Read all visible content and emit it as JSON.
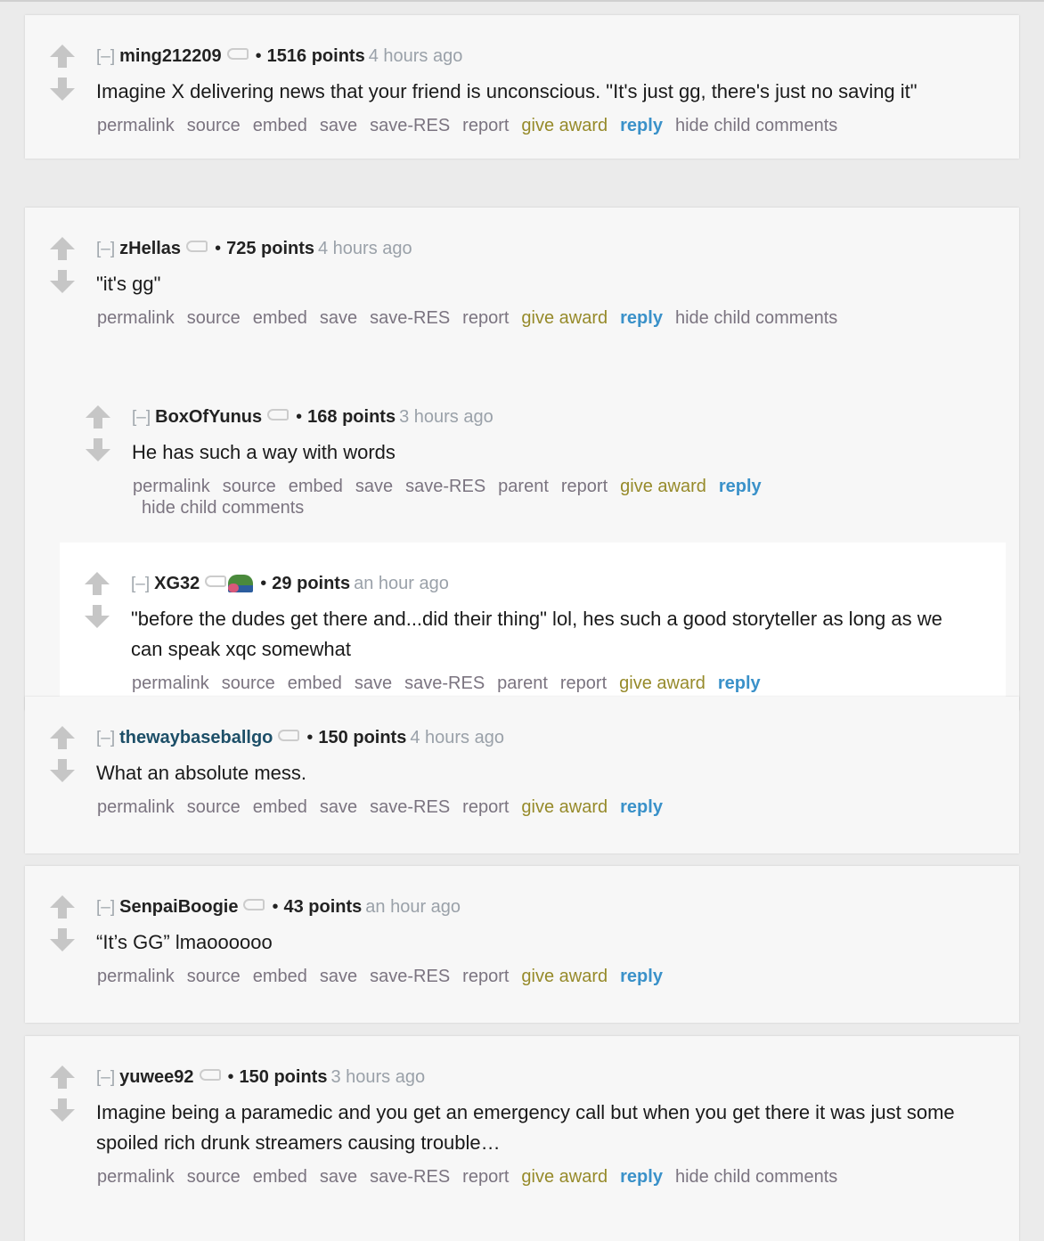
{
  "colors": {
    "background": "#ebebeb",
    "card": "#f7f7f7",
    "award": "#968a2a",
    "reply": "#3a91c9",
    "muted": "#9aa1a9"
  },
  "collapse_label": "[–]",
  "comments": [
    {
      "author": "ming212209",
      "points": "1516 points",
      "time": "4 hours ago",
      "body": "Imagine X delivering news that your friend is unconscious. \"It's just gg, there's just no saving it\"",
      "buttons": [
        "permalink",
        "source",
        "embed",
        "save",
        "save-RES",
        "report",
        "give award",
        "reply",
        "hide child comments"
      ]
    },
    {
      "author": "zHellas",
      "points": "725 points",
      "time": "4 hours ago",
      "body": "\"it's gg\"",
      "buttons": [
        "permalink",
        "source",
        "embed",
        "save",
        "save-RES",
        "report",
        "give award",
        "reply",
        "hide child comments"
      ],
      "children": [
        {
          "author": "BoxOfYunus",
          "points": "168 points",
          "time": "3 hours ago",
          "body": "He has such a way with words",
          "buttons": [
            "permalink",
            "source",
            "embed",
            "save",
            "save-RES",
            "parent",
            "report",
            "give award",
            "reply",
            "hide child comments"
          ],
          "children": [
            {
              "author": "XG32",
              "emote": "pepe-emote",
              "points": "29 points",
              "time": "an hour ago",
              "body": "\"before the dudes get there and...did their thing\" lol, hes such a good storyteller as long as we can speak xqc somewhat",
              "buttons": [
                "permalink",
                "source",
                "embed",
                "save",
                "save-RES",
                "parent",
                "report",
                "give award",
                "reply"
              ]
            }
          ]
        }
      ]
    },
    {
      "author": "thewaybaseballgo",
      "submitter": true,
      "points": "150 points",
      "time": "4 hours ago",
      "body": "What an absolute mess.",
      "buttons": [
        "permalink",
        "source",
        "embed",
        "save",
        "save-RES",
        "report",
        "give award",
        "reply"
      ]
    },
    {
      "author": "SenpaiBoogie",
      "points": "43 points",
      "time": "an hour ago",
      "body": "“It’s GG” lmaoooooo",
      "buttons": [
        "permalink",
        "source",
        "embed",
        "save",
        "save-RES",
        "report",
        "give award",
        "reply"
      ]
    },
    {
      "author": "yuwee92",
      "points": "150 points",
      "time": "3 hours ago",
      "body": "Imagine being a paramedic and you get an emergency call but when you get there it was just some spoiled rich drunk streamers causing trouble…",
      "buttons": [
        "permalink",
        "source",
        "embed",
        "save",
        "save-RES",
        "report",
        "give award",
        "reply",
        "hide child comments"
      ]
    }
  ]
}
